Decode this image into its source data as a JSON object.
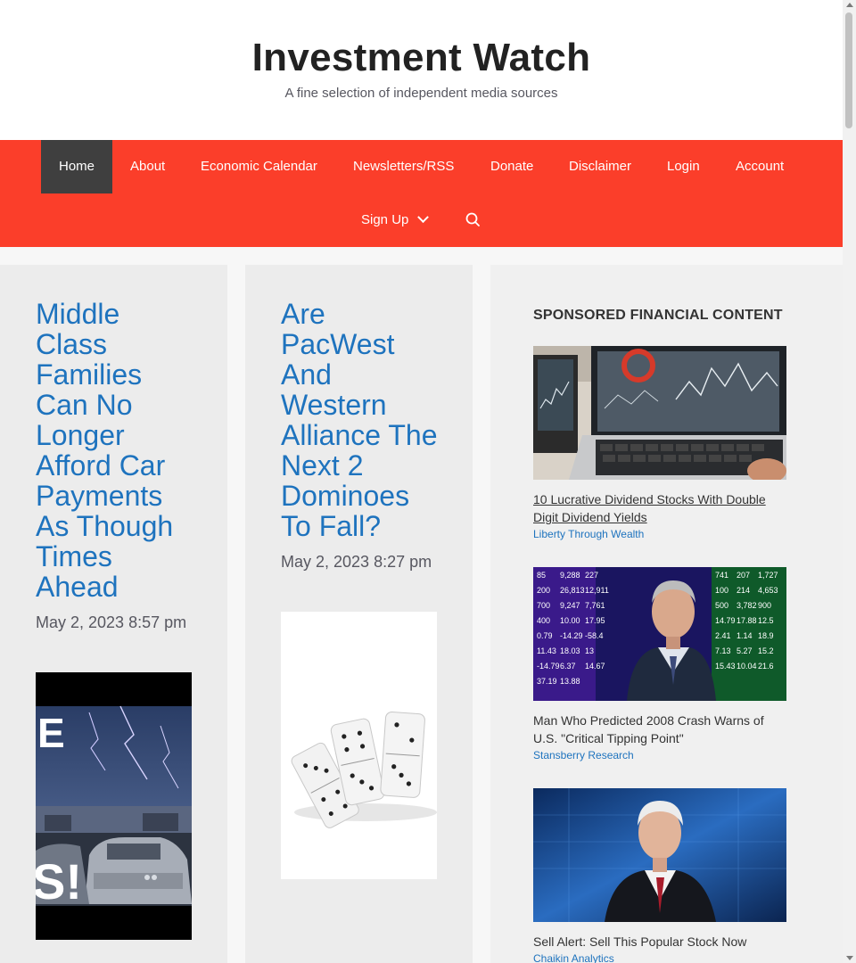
{
  "site": {
    "title": "Investment Watch",
    "tagline": "A fine selection of independent media sources"
  },
  "nav": {
    "items": [
      {
        "label": "Home",
        "active": true
      },
      {
        "label": "About"
      },
      {
        "label": "Economic Calendar"
      },
      {
        "label": "Newsletters/RSS"
      },
      {
        "label": "Donate"
      },
      {
        "label": "Disclaimer"
      },
      {
        "label": "Login"
      },
      {
        "label": "Account"
      },
      {
        "label": "Sign Up",
        "has_dropdown": true
      }
    ],
    "search_icon": "search-icon"
  },
  "posts": [
    {
      "title": "Middle Class Families Can No Longer Afford Car Payments As Though Times Ahead",
      "date": "May 2, 2023 8:57 pm",
      "thumb_overlay_top": "E",
      "thumb_overlay_bottom": "S!"
    },
    {
      "title": "Are PacWest And Western Alliance The Next 2 Dominoes To Fall?",
      "date": "May 2, 2023 8:27 pm"
    }
  ],
  "sidebar": {
    "widget_title": "SPONSORED FINANCIAL CONTENT",
    "ads": [
      {
        "title": "10 Lucrative Dividend Stocks With Double Digit Dividend Yields",
        "source": "Liberty Through Wealth"
      },
      {
        "title": "Man Who Predicted 2008 Crash Warns of U.S. \"Critical Tipping Point\"",
        "source": "Stansberry Research"
      },
      {
        "title": "Sell Alert: Sell This Popular Stock Now",
        "source": "Chaikin Analytics"
      }
    ],
    "ad2_ticker": [
      "85",
      "9,288",
      "227",
      "741",
      "207",
      "1,727",
      "200",
      "26,813",
      "12,911",
      "100",
      "214",
      "4,653",
      "700",
      "9,247",
      "7,761",
      "500",
      "3,782",
      "900",
      "400",
      "10.00",
      "17.95",
      "14.79",
      "17.88",
      "12.5",
      "0.79",
      "-14.29",
      "-58.4",
      "2.41",
      "1.14",
      "18.9",
      "11.43",
      "18.03",
      "13",
      "7.13",
      "5.27",
      "15.2",
      "-14.79",
      "6.37",
      "14.67",
      "15.43",
      "10.04",
      "21.6",
      "37.19",
      "13.88"
    ]
  },
  "colors": {
    "accent_red": "#fb3e2a",
    "link_blue": "#1e73be",
    "nav_active_bg": "#3f3f3f"
  }
}
